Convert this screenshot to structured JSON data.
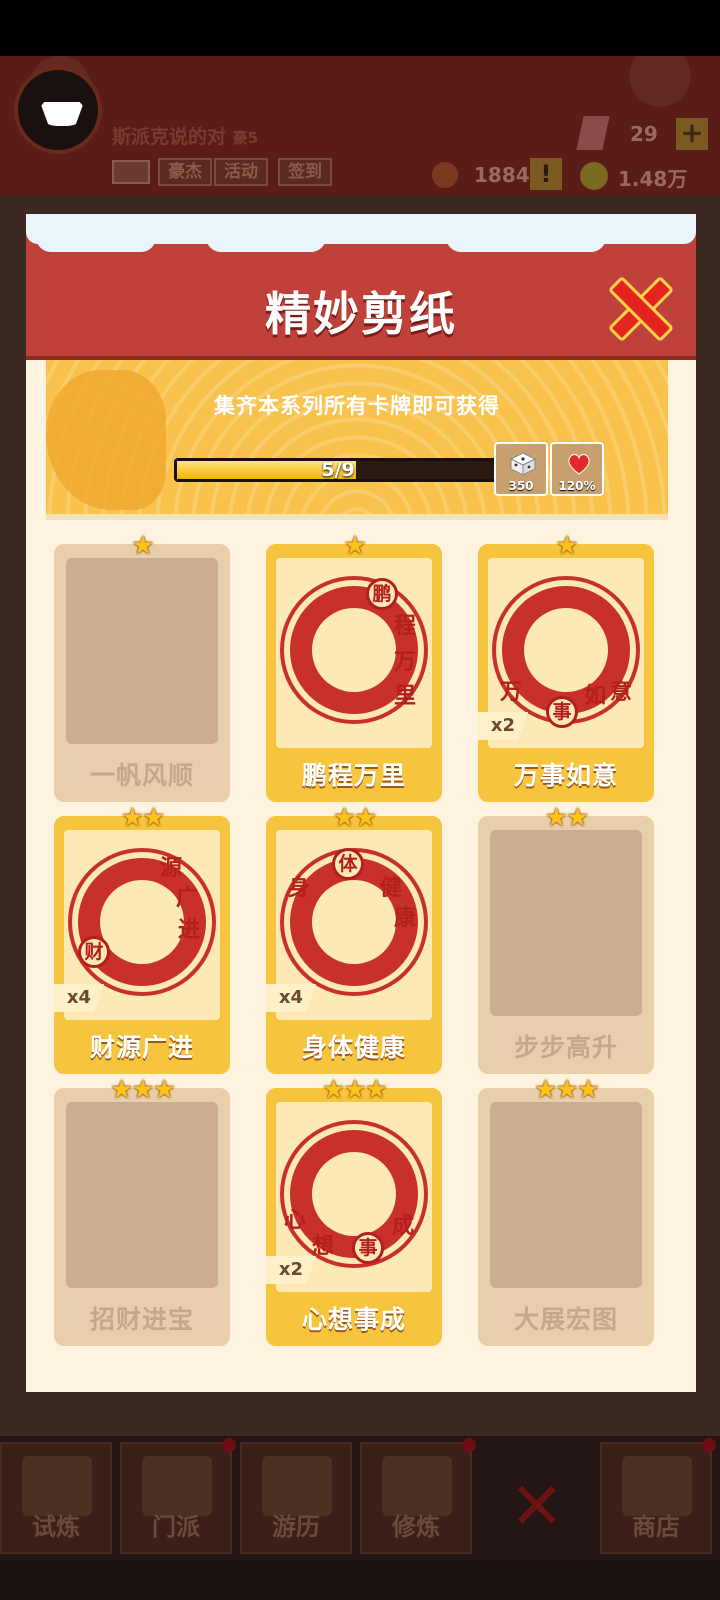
{
  "header": {
    "player_name": "斯派克说的对",
    "player_rank": "豪5",
    "buttons": [
      "豪杰",
      "活动",
      "签到"
    ],
    "gems": "29",
    "plus": "+",
    "coupons": "1884",
    "alert": "!",
    "coins": "1.48万"
  },
  "modal": {
    "title": "精妙剪纸",
    "banner_text": "集齐本系列所有卡牌即可获得",
    "progress": {
      "text": "5/9",
      "current": 5,
      "total": 9
    },
    "rewards": [
      {
        "icon": "dice-icon",
        "value": "350"
      },
      {
        "icon": "heart-icon",
        "value": "120%"
      }
    ],
    "cards": [
      {
        "name": "一帆风顺",
        "stars": "★",
        "owned": false,
        "count": ""
      },
      {
        "name": "鹏程万里",
        "stars": "★",
        "owned": true,
        "count": "",
        "chars": [
          "鹏",
          "程",
          "万",
          "里"
        ]
      },
      {
        "name": "万事如意",
        "stars": "★",
        "owned": true,
        "count": "x2",
        "chars": [
          "万",
          "事",
          "如",
          "意"
        ]
      },
      {
        "name": "财源广进",
        "stars": "★★",
        "owned": true,
        "count": "x4",
        "chars": [
          "源",
          "广",
          "进",
          "财"
        ]
      },
      {
        "name": "身体健康",
        "stars": "★★",
        "owned": true,
        "count": "x4",
        "chars": [
          "身",
          "体",
          "健",
          "康"
        ]
      },
      {
        "name": "步步高升",
        "stars": "★★",
        "owned": false,
        "count": ""
      },
      {
        "name": "招财进宝",
        "stars": "★★★",
        "owned": false,
        "count": ""
      },
      {
        "name": "心想事成",
        "stars": "★★★",
        "owned": true,
        "count": "x2",
        "chars": [
          "心",
          "想",
          "事",
          "成"
        ]
      },
      {
        "name": "大展宏图",
        "stars": "★★★",
        "owned": false,
        "count": ""
      }
    ]
  },
  "nav": {
    "tabs": [
      "试炼",
      "门派",
      "游历",
      "修炼",
      "商店"
    ],
    "close": "✕"
  }
}
